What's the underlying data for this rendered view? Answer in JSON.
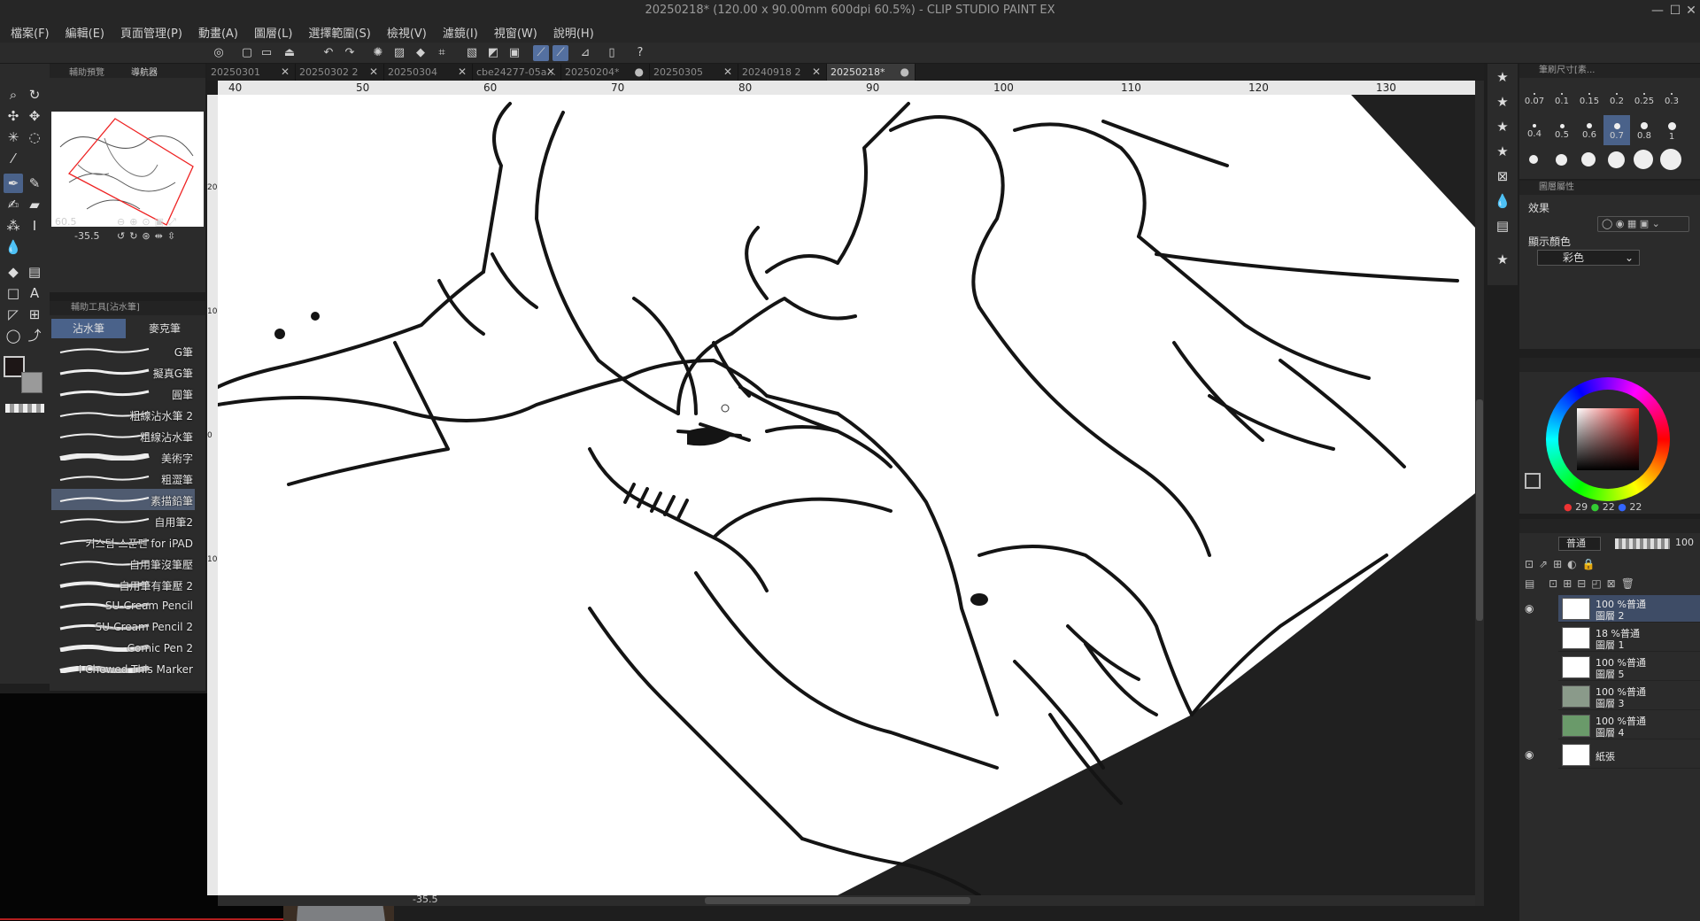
{
  "window": {
    "title": "20250218* (120.00 x 90.00mm 600dpi 60.5%)  - CLIP STUDIO PAINT EX",
    "minimize": "—",
    "maximize": "☐",
    "close": "✕"
  },
  "menu": [
    "檔案(F)",
    "編輯(E)",
    "頁面管理(P)",
    "動畫(A)",
    "圖層(L)",
    "選擇範圍(S)",
    "檢視(V)",
    "濾鏡(I)",
    "視窗(W)",
    "說明(H)"
  ],
  "navigator": {
    "tabs": [
      "輔助預覽",
      "導航器"
    ],
    "zoom": "60.5",
    "rotation": "-35.5"
  },
  "subtool": {
    "header": "輔助工具[沾水筆]",
    "tabs": [
      "沾水筆",
      "麥克筆"
    ],
    "brushes": [
      "G筆",
      "擬真G筆",
      "圓筆",
      "粗線沾水筆 2",
      "粗線沾水筆",
      "美術字",
      "粗澀筆",
      "素描鉛筆",
      "自用筆2",
      "커스텀 스푼펜 for iPAD",
      "自用筆沒筆壓",
      "自用筆有筆壓 2",
      "SU-Cream Pencil",
      "SU-Cream Pencil 2",
      "Comic Pen 2",
      "I Chewed This Marker"
    ],
    "selected": "素描鉛筆"
  },
  "doc_tabs": [
    "20250301",
    "20250302 2",
    "20250304",
    "cbe24277-05a...",
    "20250204*",
    "20250305",
    "20240918 2",
    "20250218*"
  ],
  "active_doc_tab": "20250218*",
  "ruler": {
    "top": [
      "40",
      "50",
      "60",
      "70",
      "80",
      "90",
      "100",
      "110",
      "120",
      "130"
    ],
    "left": [
      "20",
      "10",
      "0",
      "10"
    ]
  },
  "bottom_rotation": "-35.5",
  "brush_size": {
    "header": "筆刷尺寸[素...",
    "sizes": [
      "0.07",
      "0.1",
      "0.15",
      "0.2",
      "0.25",
      "0.3",
      "0.4",
      "0.5",
      "0.6",
      "0.7",
      "0.8",
      "1"
    ],
    "selected": "0.7"
  },
  "layer_property": {
    "header": "圖層屬性",
    "effect_label": "效果",
    "display_color_label": "顯示顏色",
    "display_color_value": "彩色"
  },
  "color": {
    "rgb": [
      "29",
      "22",
      "22"
    ],
    "main": "#1d1616",
    "sub": "#ffffff"
  },
  "layers": {
    "blend_mode": "普通",
    "opacity": "100",
    "items": [
      {
        "line1": "100 %普通",
        "line2": "圖層 2",
        "selected": true,
        "visible": true
      },
      {
        "line1": "18 %普通",
        "line2": "圖層 1",
        "selected": false,
        "visible": false
      },
      {
        "line1": "100 %普通",
        "line2": "圖層 5",
        "selected": false,
        "visible": false
      },
      {
        "line1": "100 %普通",
        "line2": "圖層 3",
        "selected": false,
        "visible": false
      },
      {
        "line1": "100 %普通",
        "line2": "圖層 4",
        "selected": false,
        "visible": false
      },
      {
        "line1": "",
        "line2": "紙張",
        "selected": false,
        "visible": true
      }
    ]
  },
  "icons": {
    "pen": "pen-icon",
    "eye": "eye-icon",
    "search": "zoom-icon"
  }
}
